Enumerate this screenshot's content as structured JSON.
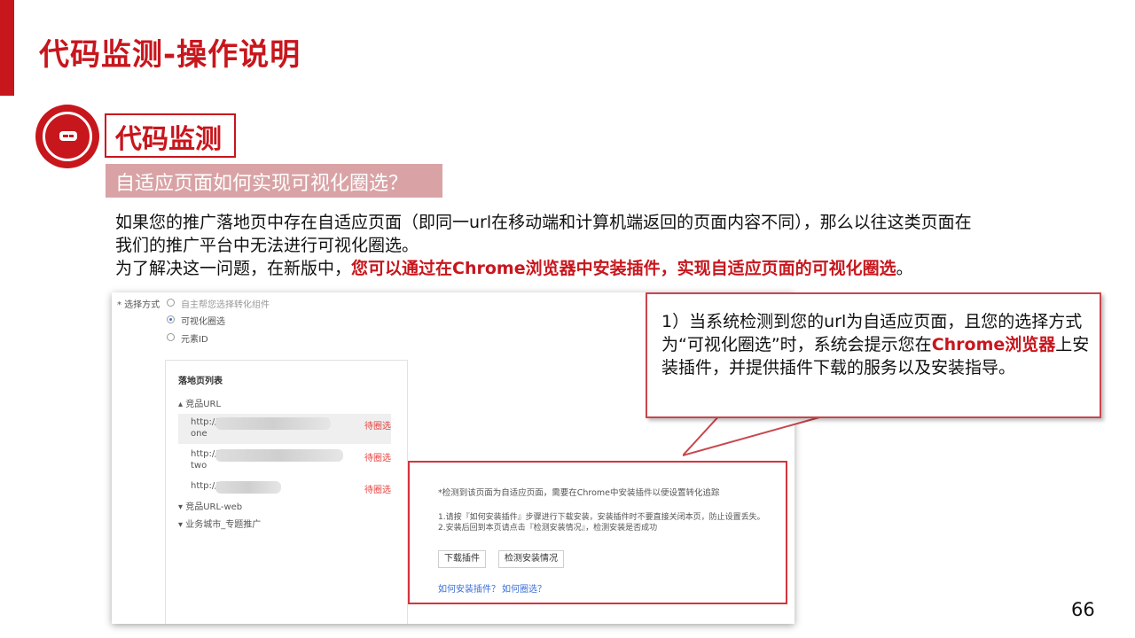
{
  "slide": {
    "title": "代码监测-操作说明",
    "section_title": "代码监测",
    "subtitle": "自适应页面如何实现可视化圈选？",
    "para_line1": "如果您的推广落地页中存在自适应页面（即同一url在移动端和计算机端返回的页面内容不同），那么以往这类页面在",
    "para_line2": "我们的推广平台中无法进行可视化圈选。",
    "para_line3_prefix": "为了解决这一问题，在新版中，",
    "para_line3_highlight": "您可以通过在Chrome浏览器中安装插件，实现自适应页面的可视化圈选",
    "para_line3_suffix": "。",
    "page_number": "66"
  },
  "callout": {
    "text_prefix": "1）当系统检测到您的url为自适应页面，且您的选择方式为“可视化圈选”时，系统会提示您在",
    "text_highlight": "Chrome浏览器",
    "text_suffix": "上安装插件，并提供插件下载的服务以及安装指导。"
  },
  "screenshot": {
    "select_label": "* 选择方式",
    "options": [
      "自主帮您选择转化组件",
      "可视化圈选",
      "元素ID"
    ],
    "panel_title": "落地页列表",
    "group1": "▴ 竞品URL",
    "rows": [
      {
        "prefix": "http://",
        "suffix": "one",
        "action": "待圈选"
      },
      {
        "prefix": "http://",
        "suffix": "two",
        "action": "待圈选"
      },
      {
        "prefix": "http://",
        "suffix": "",
        "action": "待圈选"
      }
    ],
    "group2": "▾ 竞品URL-web",
    "group3": "▾ 业务城市_专题推广",
    "detect_notice": "*检测到该页面为自适应页面，需要在Chrome中安装插件以便设置转化追踪",
    "detect_step1": "1.请按『如何安装插件』步骤进行下载安装，安装插件时不要直接关闭本页，防止设置丢失。",
    "detect_step2": "2.安装后回到本页请点击『检测安装情况』，检测安装是否成功",
    "btn_download": "下载插件",
    "btn_check": "检测安装情况",
    "link_install": "如何安装插件？",
    "link_circle": "如何圈选？"
  },
  "colors": {
    "accent": "#c8161d",
    "subtitle_bg": "#d9a3a5",
    "link": "#3a6fd8"
  }
}
